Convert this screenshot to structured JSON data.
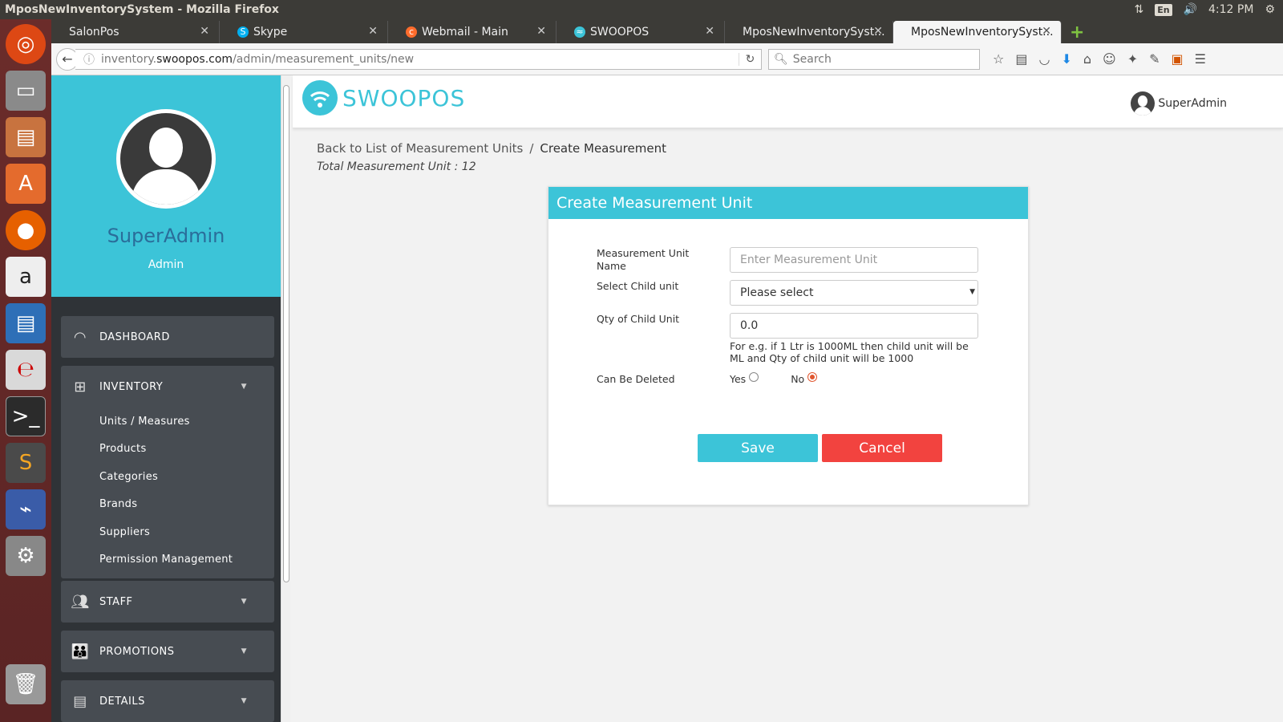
{
  "os": {
    "window_title": "MposNewInventorySystem - Mozilla Firefox",
    "lang": "En",
    "time": "4:12 PM"
  },
  "tabs": [
    {
      "label": "SalonPos",
      "icon": "none"
    },
    {
      "label": "Skype",
      "icon": "skype-icon"
    },
    {
      "label": "Webmail - Main",
      "icon": "cpanel-icon"
    },
    {
      "label": "SWOOPOS",
      "icon": "swoopos-icon"
    },
    {
      "label": "MposNewInventorySyst...",
      "icon": "none"
    },
    {
      "label": "MposNewInventorySyst...",
      "icon": "none",
      "active": true
    }
  ],
  "urlbar": {
    "prefix": "inventory.",
    "host": "swoopos.com",
    "path": "/admin/measurement_units/new"
  },
  "searchbar": {
    "placeholder": "Search"
  },
  "sidebar": {
    "profile_name": "SuperAdmin",
    "profile_role": "Admin",
    "dashboard": "DASHBOARD",
    "inventory": "INVENTORY",
    "inventory_items": [
      "Units / Measures",
      "Products",
      "Categories",
      "Brands",
      "Suppliers",
      "Permission Management"
    ],
    "staff": "STAFF",
    "promotions": "PROMOTIONS",
    "details": "DETAILS"
  },
  "header": {
    "logo_text": "SWOOPOS",
    "user_name": "SuperAdmin"
  },
  "breadcrumb": {
    "back_link": "Back to List of Measurement Units",
    "separator": "/",
    "current": "Create Measurement"
  },
  "total_text": "Total Measurement Unit : 12",
  "form": {
    "title": "Create Measurement Unit",
    "name_label": "Measurement Unit Name",
    "name_placeholder": "Enter Measurement Unit",
    "child_label": "Select Child unit",
    "child_value": "Please select",
    "qty_label": "Qty of Child Unit",
    "qty_value": "0.0",
    "qty_hint": "For e.g. if 1 Ltr is 1000ML then child unit will be ML and Qty of child unit will be 1000",
    "deletable_label": "Can Be Deleted",
    "yes_label": "Yes",
    "no_label": "No",
    "deletable_selected": "No",
    "save_label": "Save",
    "cancel_label": "Cancel"
  },
  "colors": {
    "accent": "#3cc4d8",
    "cancel": "#f2433f",
    "sidebar_bg": "#2f3337",
    "menu_block": "#474c52"
  }
}
